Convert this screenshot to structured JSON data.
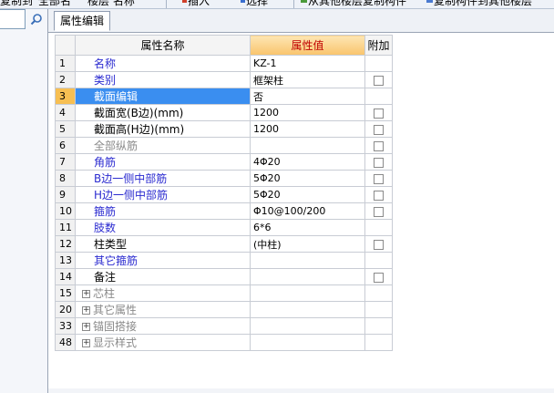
{
  "toolbar": {
    "items": [
      "复制到",
      "全部名",
      "楼层 名称",
      "插入",
      "选择",
      "从其他楼层复制构件",
      "复制构件到其他楼层"
    ]
  },
  "search": {
    "placeholder": ""
  },
  "tab": {
    "label": "属性编辑"
  },
  "grid": {
    "headers": {
      "name": "属性名称",
      "value": "属性值",
      "add": "附加"
    },
    "rows": [
      {
        "num": "1",
        "name": "名称",
        "value": "KZ-1",
        "style": "blue",
        "checkbox": false,
        "checked": false
      },
      {
        "num": "2",
        "name": "类别",
        "value": "框架柱",
        "style": "blue",
        "checkbox": true,
        "checked": false
      },
      {
        "num": "3",
        "name": "截面编辑",
        "value": "否",
        "style": "blue",
        "checkbox": false,
        "checked": false,
        "selected": true
      },
      {
        "num": "4",
        "name": "截面宽(B边)(mm)",
        "value": "1200",
        "style": "black",
        "checkbox": true,
        "checked": false
      },
      {
        "num": "5",
        "name": "截面高(H边)(mm)",
        "value": "1200",
        "style": "black",
        "checkbox": true,
        "checked": false
      },
      {
        "num": "6",
        "name": "全部纵筋",
        "value": "",
        "style": "gray",
        "checkbox": true,
        "checked": false
      },
      {
        "num": "7",
        "name": "角筋",
        "value": "4Φ20",
        "style": "blue",
        "checkbox": true,
        "checked": false
      },
      {
        "num": "8",
        "name": "B边一侧中部筋",
        "value": "5Φ20",
        "style": "blue",
        "checkbox": true,
        "checked": false
      },
      {
        "num": "9",
        "name": "H边一侧中部筋",
        "value": "5Φ20",
        "style": "blue",
        "checkbox": true,
        "checked": false
      },
      {
        "num": "10",
        "name": "箍筋",
        "value": "Φ10@100/200",
        "style": "blue",
        "checkbox": true,
        "checked": false
      },
      {
        "num": "11",
        "name": "肢数",
        "value": "6*6",
        "style": "blue",
        "checkbox": false,
        "checked": false
      },
      {
        "num": "12",
        "name": "柱类型",
        "value": "(中柱)",
        "style": "black",
        "checkbox": true,
        "checked": false
      },
      {
        "num": "13",
        "name": "其它箍筋",
        "value": "",
        "style": "blue",
        "checkbox": false,
        "checked": false
      },
      {
        "num": "14",
        "name": "备注",
        "value": "",
        "style": "black",
        "checkbox": true,
        "checked": false
      },
      {
        "num": "15",
        "name": "芯柱",
        "value": "",
        "style": "gray",
        "checkbox": false,
        "checked": false,
        "expandable": true
      },
      {
        "num": "20",
        "name": "其它属性",
        "value": "",
        "style": "gray",
        "checkbox": false,
        "checked": false,
        "expandable": true
      },
      {
        "num": "33",
        "name": "锚固搭接",
        "value": "",
        "style": "gray",
        "checkbox": false,
        "checked": false,
        "expandable": true
      },
      {
        "num": "48",
        "name": "显示样式",
        "value": "",
        "style": "gray",
        "checkbox": false,
        "checked": false,
        "expandable": true
      }
    ]
  },
  "colors": {
    "selected_name_bg": "#3a8ef0",
    "selected_num_bg": "#f7bf52",
    "value_header_text": "#c00000",
    "blue_text": "#2b2bd0"
  }
}
